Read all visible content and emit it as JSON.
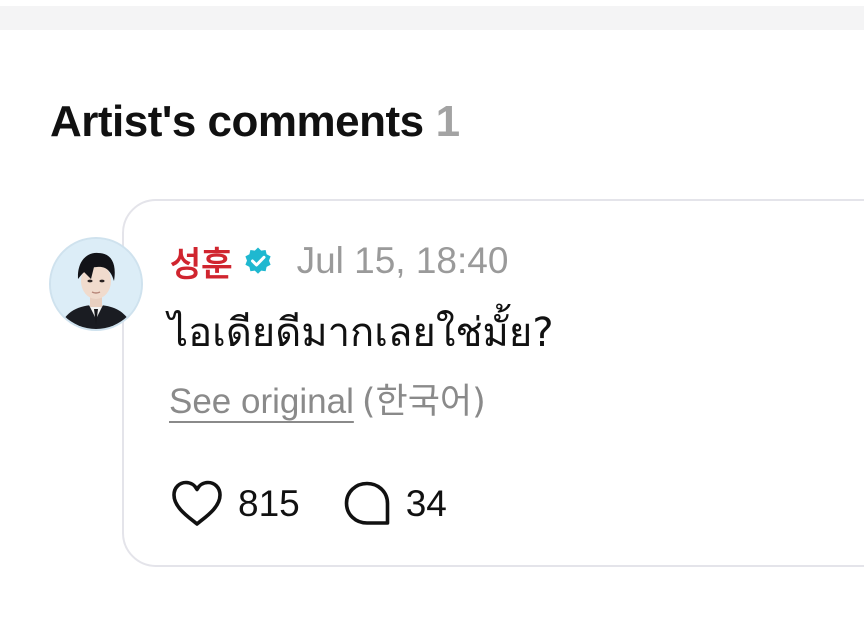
{
  "section": {
    "title": "Artist's comments",
    "count": "1"
  },
  "comment": {
    "author": "성훈",
    "verified": true,
    "timestamp": "Jul 15, 18:40",
    "text": "ไอเดียดีมากเลยใช่มั้ย?",
    "see_original_label": "See original",
    "original_language": "(한국어)",
    "likes": "815",
    "replies": "34",
    "icons": {
      "verified": "verified-badge-icon",
      "like": "heart-icon",
      "reply": "speech-bubble-icon"
    }
  },
  "colors": {
    "author_name": "#d0252f",
    "verified_badge": "#1fb8d0",
    "muted_text": "#9a9a9a",
    "card_border": "#e4e4ea",
    "top_strip": "#f4f4f5"
  }
}
